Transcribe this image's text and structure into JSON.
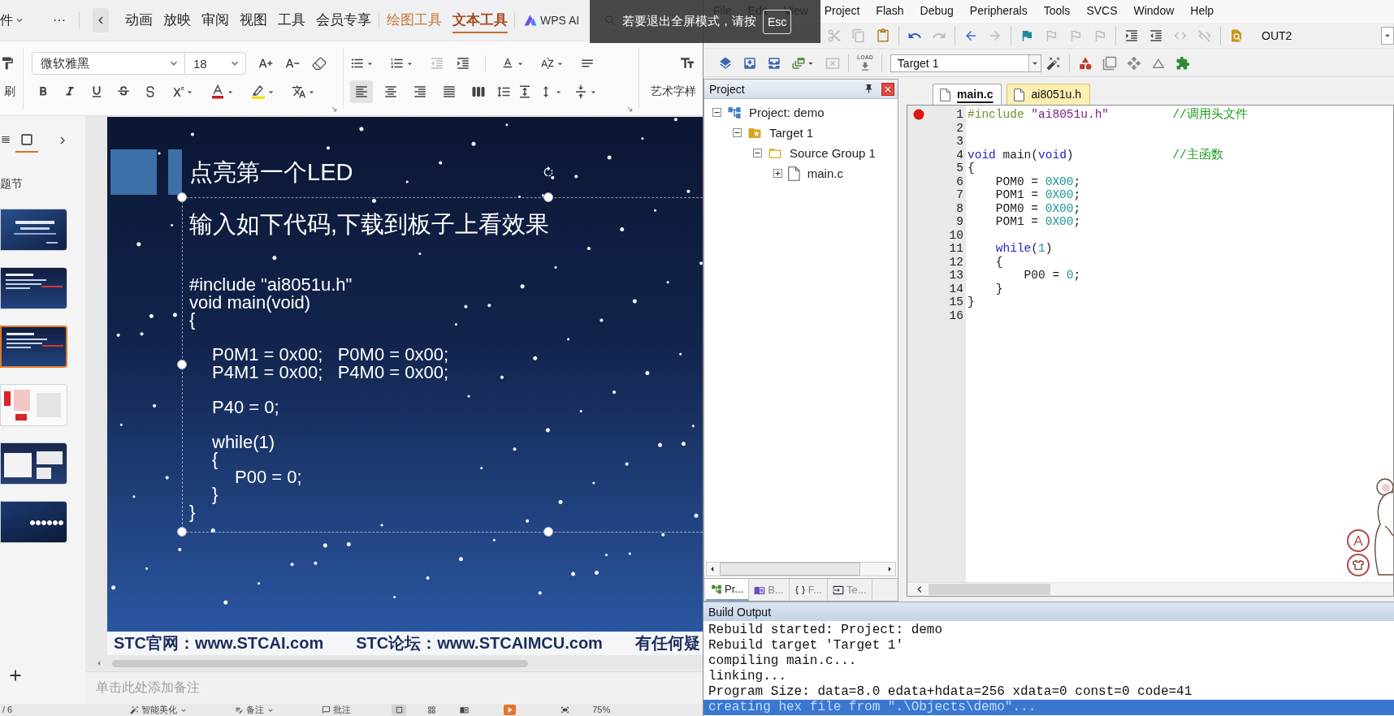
{
  "fullscreen_hint": {
    "message": "若要退出全屏模式，请按",
    "key": "Esc"
  },
  "wps": {
    "tab_bar": {
      "file_menu": "件",
      "overflow": "···",
      "tabs": [
        {
          "label": "动画",
          "kind": "standard",
          "selected": false
        },
        {
          "label": "放映",
          "kind": "standard",
          "selected": false
        },
        {
          "label": "审阅",
          "kind": "standard",
          "selected": false
        },
        {
          "label": "视图",
          "kind": "standard",
          "selected": false
        },
        {
          "label": "工具",
          "kind": "standard",
          "selected": false
        },
        {
          "label": "会员专享",
          "kind": "standard",
          "selected": false
        },
        {
          "label": "绘图工具",
          "kind": "contextual",
          "selected": false
        },
        {
          "label": "文本工具",
          "kind": "contextual",
          "selected": true
        }
      ],
      "ai_button": "WPS AI"
    },
    "ribbon": {
      "painter_label": "刷",
      "font_name": "微软雅黑",
      "font_size": "18",
      "font_buttons_top": [
        {
          "kind": "grow-font"
        },
        {
          "kind": "shrink-font"
        },
        {
          "kind": "clear-format"
        }
      ],
      "font_buttons_bottom": [
        {
          "kind": "bold",
          "menu": false
        },
        {
          "kind": "italic",
          "menu": false
        },
        {
          "kind": "underline",
          "menu": false
        },
        {
          "kind": "strikethrough",
          "menu": false
        },
        {
          "kind": "shadow",
          "menu": false
        },
        {
          "kind": "superscript",
          "menu": true
        },
        {
          "kind": "font-color",
          "menu": true
        },
        {
          "kind": "highlight",
          "menu": true
        },
        {
          "kind": "phonetic",
          "menu": true
        }
      ],
      "list_buttons": [
        {
          "kind": "bullets",
          "menu": true,
          "disabled": false
        },
        {
          "kind": "numbering",
          "menu": true,
          "disabled": false
        },
        {
          "kind": "outdent",
          "menu": false,
          "disabled": true
        },
        {
          "kind": "indent",
          "menu": false,
          "disabled": false
        }
      ],
      "text_buttons": [
        {
          "kind": "text-effects",
          "menu": true
        },
        {
          "kind": "text-direction",
          "menu": true
        },
        {
          "kind": "text-box",
          "menu": false
        }
      ],
      "alignment": [
        {
          "kind": "left",
          "selected": true
        },
        {
          "kind": "center",
          "selected": false
        },
        {
          "kind": "right",
          "selected": false
        },
        {
          "kind": "justify",
          "selected": false
        },
        {
          "kind": "distributed",
          "selected": false
        }
      ],
      "spacing_buttons": [
        {
          "kind": "line-spacing",
          "menu": false
        },
        {
          "kind": "paragraph-spacing",
          "menu": false
        },
        {
          "kind": "spacing-options",
          "menu": true
        },
        {
          "kind": "vertical-align",
          "menu": true
        }
      ],
      "wordart_label": "艺术字样"
    },
    "slide_panel": {
      "views": [
        {
          "kind": "outline",
          "selected": false
        },
        {
          "kind": "slides",
          "selected": true
        }
      ],
      "section": "题节",
      "slides": [
        {
          "kind": "title",
          "selected": false
        },
        {
          "kind": "content",
          "selected": false
        },
        {
          "kind": "content",
          "selected": true
        },
        {
          "kind": "photos",
          "selected": false
        },
        {
          "kind": "screenshots",
          "selected": false
        },
        {
          "kind": "closing",
          "selected": false
        }
      ]
    },
    "slide": {
      "title": "点亮第一个LED",
      "subtitle": "输入如下代码,下载到板子上看效果",
      "code_blocks": [
        [
          "#include \"ai8051u.h\"",
          "void main(void)",
          "{"
        ],
        [
          "    P0M1 = 0x00;   P0M0 = 0x00;",
          "    P4M1 = 0x00;   P4M0 = 0x00;"
        ],
        [
          "    P40 = 0;"
        ],
        [
          "    while(1)",
          "    {",
          "        P00 = 0;",
          "    }",
          "}"
        ]
      ],
      "footer": [
        "STC官网：www.STCAI.com",
        "STC论坛：www.STCAIMCU.com",
        "有任何疑"
      ]
    },
    "notes": {
      "placeholder": "单击此处添加备注"
    },
    "status_bar": {
      "page": "/ 6",
      "tools": [
        {
          "kind": "beautify",
          "label": "智能美化",
          "menu": true
        },
        {
          "kind": "notes",
          "label": "备注",
          "menu": true
        },
        {
          "kind": "comments",
          "label": "批注",
          "menu": false
        }
      ],
      "views": [
        {
          "kind": "normal",
          "selected": true
        },
        {
          "kind": "sorter",
          "selected": false
        },
        {
          "kind": "reading",
          "selected": false
        }
      ],
      "zoom": "75%"
    }
  },
  "keil": {
    "menu": [
      "File",
      "Edit",
      "View",
      "Project",
      "Flash",
      "Debug",
      "Peripherals",
      "Tools",
      "SVCS",
      "Window",
      "Help"
    ],
    "toolbar_1": [
      {
        "items": [
          {
            "kind": "cut",
            "disabled": true
          },
          {
            "kind": "copy",
            "disabled": true
          },
          {
            "kind": "paste",
            "disabled": false
          }
        ]
      },
      {
        "items": [
          {
            "kind": "undo",
            "disabled": false
          },
          {
            "kind": "redo",
            "disabled": true
          }
        ]
      },
      {
        "items": [
          {
            "kind": "back",
            "disabled": false
          },
          {
            "kind": "forward",
            "disabled": true
          }
        ]
      },
      {
        "items": [
          {
            "kind": "bookmark",
            "disabled": false
          },
          {
            "kind": "previous-bookmark",
            "disabled": true
          },
          {
            "kind": "next-bookmark",
            "disabled": true
          },
          {
            "kind": "clear-bookmarks",
            "disabled": true
          }
        ]
      },
      {
        "items": [
          {
            "kind": "indent",
            "disabled": false
          },
          {
            "kind": "unindent",
            "disabled": false
          },
          {
            "kind": "comment",
            "disabled": true
          },
          {
            "kind": "uncomment",
            "disabled": true
          }
        ]
      },
      {
        "items": [
          {
            "kind": "find-in-files",
            "disabled": false
          },
          {
            "kind": "find-combo",
            "value": "OUT2",
            "disabled": false
          }
        ]
      }
    ],
    "toolbar_2": [
      {
        "items": [
          {
            "kind": "translate",
            "disabled": false
          },
          {
            "kind": "build",
            "disabled": false
          },
          {
            "kind": "rebuild",
            "disabled": false
          },
          {
            "kind": "batch-build",
            "disabled": false
          },
          {
            "kind": "stop-build",
            "disabled": true
          }
        ]
      },
      {
        "items": [
          {
            "kind": "download",
            "caption": "LOAD",
            "disabled": false
          }
        ]
      },
      {
        "items": [
          {
            "kind": "target-combo",
            "value": "Target 1",
            "disabled": false
          },
          {
            "kind": "target-options",
            "disabled": false
          }
        ]
      },
      {
        "items": [
          {
            "kind": "manage-components",
            "disabled": false
          },
          {
            "kind": "environment",
            "disabled": false
          },
          {
            "kind": "event-recorder",
            "disabled": false
          },
          {
            "kind": "pack-installer",
            "disabled": false
          },
          {
            "kind": "multi-project",
            "disabled": false
          }
        ]
      }
    ],
    "project_panel": {
      "title": "Project",
      "tree": [
        {
          "label": "Project: demo",
          "kind": "project",
          "expanded": true,
          "children": [
            {
              "label": "Target 1",
              "kind": "target",
              "expanded": true,
              "children": [
                {
                  "label": "Source Group 1",
                  "kind": "group",
                  "expanded": true,
                  "children": [
                    {
                      "label": "main.c",
                      "kind": "file",
                      "expanded": false
                    }
                  ]
                }
              ]
            }
          ]
        }
      ],
      "tabs": [
        {
          "label": "Pr...",
          "kind": "project",
          "selected": true
        },
        {
          "label": "B...",
          "kind": "books",
          "selected": false
        },
        {
          "label": "F...",
          "kind": "functions",
          "selected": false
        },
        {
          "label": "Te...",
          "kind": "templates",
          "selected": false
        }
      ]
    },
    "editor": {
      "tabs": [
        {
          "label": "main.c",
          "selected": true
        },
        {
          "label": "ai8051u.h",
          "selected": false
        }
      ],
      "lines": [
        {
          "number": "1",
          "breakpoint": true,
          "tokens": [
            {
              "kind": "preprocessor",
              "text": "#include"
            },
            {
              "kind": "string",
              "text": " \"ai8051u.h\""
            },
            {
              "kind": "comment",
              "text": "         //调用头文件"
            }
          ]
        },
        {
          "number": "2",
          "breakpoint": false
        },
        {
          "number": "3",
          "breakpoint": false
        },
        {
          "number": "4",
          "breakpoint": false,
          "tokens": [
            {
              "kind": "keyword",
              "text": "void"
            },
            {
              "kind": "plain",
              "text": " main("
            },
            {
              "kind": "keyword",
              "text": "void"
            },
            {
              "kind": "plain",
              "text": ")"
            },
            {
              "kind": "comment",
              "text": "              //主函数"
            }
          ]
        },
        {
          "number": "5",
          "breakpoint": false,
          "tokens": [
            {
              "kind": "plain",
              "text": "{"
            }
          ]
        },
        {
          "number": "6",
          "breakpoint": false,
          "tokens": [
            {
              "kind": "plain",
              "text": "    POM0 = "
            },
            {
              "kind": "number",
              "text": "0X00"
            },
            {
              "kind": "plain",
              "text": ";"
            }
          ]
        },
        {
          "number": "7",
          "breakpoint": false,
          "tokens": [
            {
              "kind": "plain",
              "text": "    POM1 = "
            },
            {
              "kind": "number",
              "text": "0X00"
            },
            {
              "kind": "plain",
              "text": ";"
            }
          ]
        },
        {
          "number": "8",
          "breakpoint": false,
          "tokens": [
            {
              "kind": "plain",
              "text": "    POM0 = "
            },
            {
              "kind": "number",
              "text": "0X00"
            },
            {
              "kind": "plain",
              "text": ";"
            }
          ]
        },
        {
          "number": "9",
          "breakpoint": false,
          "tokens": [
            {
              "kind": "plain",
              "text": "    POM1 = "
            },
            {
              "kind": "number",
              "text": "0X00"
            },
            {
              "kind": "plain",
              "text": ";"
            }
          ]
        },
        {
          "number": "10",
          "breakpoint": false
        },
        {
          "number": "11",
          "breakpoint": false,
          "tokens": [
            {
              "kind": "keyword",
              "text": "    while"
            },
            {
              "kind": "plain",
              "text": "("
            },
            {
              "kind": "number",
              "text": "1"
            },
            {
              "kind": "plain",
              "text": ")"
            }
          ]
        },
        {
          "number": "12",
          "breakpoint": false,
          "tokens": [
            {
              "kind": "plain",
              "text": "    {"
            }
          ]
        },
        {
          "number": "13",
          "breakpoint": false,
          "tokens": [
            {
              "kind": "plain",
              "text": "        P00 = "
            },
            {
              "kind": "number",
              "text": "0"
            },
            {
              "kind": "plain",
              "text": ";"
            }
          ]
        },
        {
          "number": "14",
          "breakpoint": false,
          "tokens": [
            {
              "kind": "plain",
              "text": "    }"
            }
          ]
        },
        {
          "number": "15",
          "breakpoint": false,
          "tokens": [
            {
              "kind": "plain",
              "text": "}"
            }
          ]
        },
        {
          "number": "16",
          "breakpoint": false
        }
      ]
    },
    "overlay_badge": "A",
    "build_output": {
      "title": "Build Output",
      "lines": [
        {
          "text": "Rebuild started: Project: demo",
          "selected": false
        },
        {
          "text": "Rebuild target 'Target 1'",
          "selected": false
        },
        {
          "text": "compiling main.c...",
          "selected": false
        },
        {
          "text": "linking...",
          "selected": false
        },
        {
          "text": "Program Size: data=8.0 edata+hdata=256 xdata=0 const=0 code=41",
          "selected": false
        },
        {
          "text": "creating hex file from \".\\Objects\\demo\"...",
          "selected": true
        }
      ]
    }
  }
}
